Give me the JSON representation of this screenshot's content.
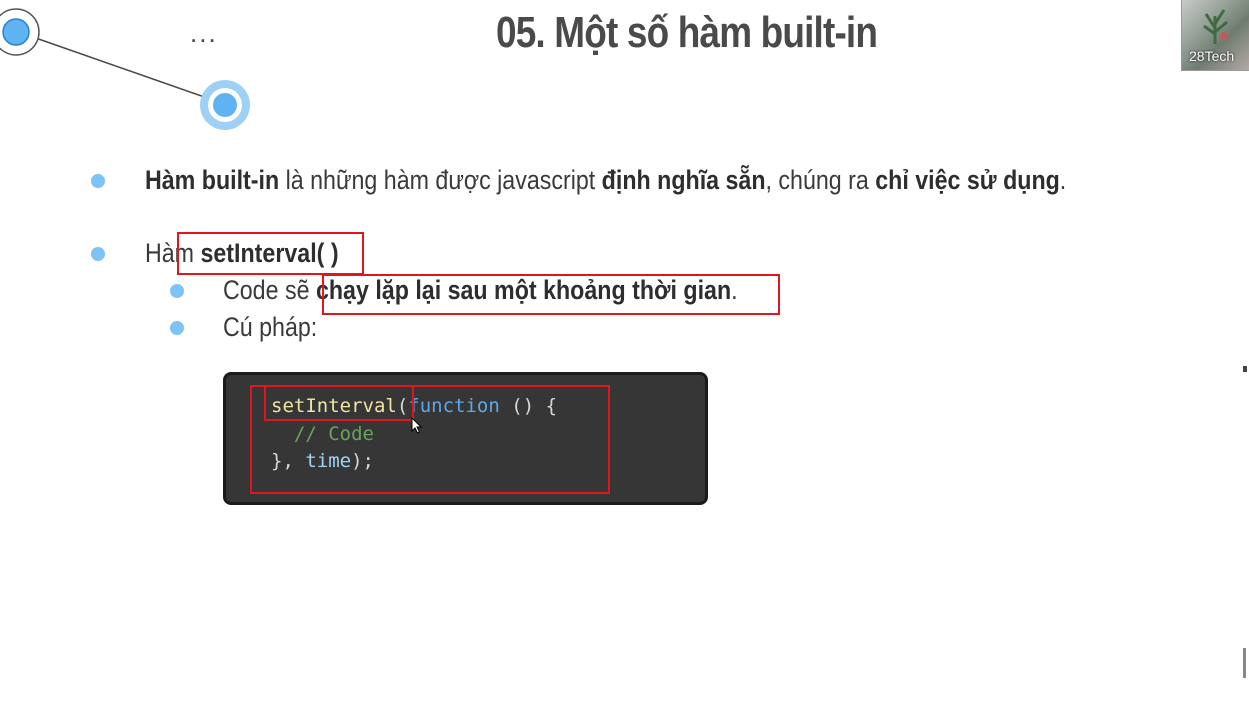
{
  "slide": {
    "ellipsis": "...",
    "title": "05. Một số hàm built-in"
  },
  "bullets": {
    "b1": {
      "term": "Hàm built-in",
      "mid": " là những hàm được javascript ",
      "bold1": "định nghĩa sẵn",
      "mid2": ", chúng ra ",
      "bold2": "chỉ việc sử dụng",
      "end": "."
    },
    "b2": {
      "prefix": "Hàm ",
      "bold": "setInterval( )"
    },
    "b2_sub1": {
      "prefix": "Code sẽ ",
      "bold": "chạy lặp lại sau một khoảng thời gian",
      "end": "."
    },
    "b2_sub2": {
      "text": "Cú pháp:"
    }
  },
  "code": {
    "l1_fn": "setInterval",
    "l1_paren": "(",
    "l1_kw": "function",
    "l1_rest": " () {",
    "l2_comment": "  // Code",
    "l3_open": "}, ",
    "l3_id": "time",
    "l3_close": ");"
  },
  "webcam": {
    "label": "28Tech"
  },
  "colors": {
    "bullet": "#7cc3f7",
    "highlight_box": "#e0161e",
    "code_bg": "#363636"
  }
}
